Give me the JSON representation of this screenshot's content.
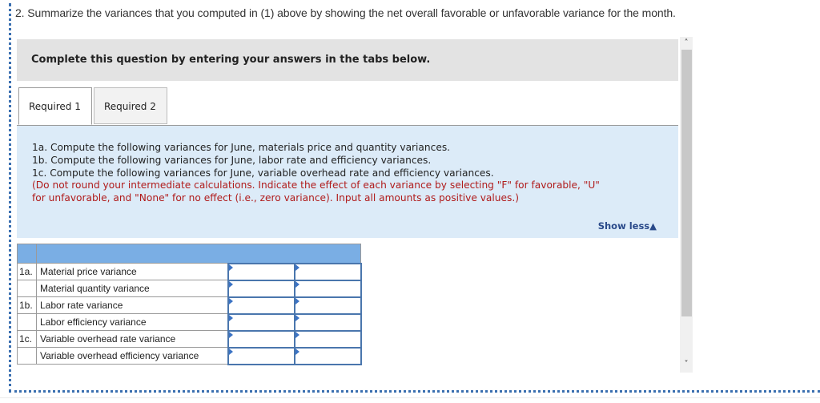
{
  "question": {
    "text": "2. Summarize the variances that you computed in (1) above by showing the net overall favorable or unfavorable variance for the month."
  },
  "instruction_bar": {
    "text": "Complete this question by entering your answers in the tabs below."
  },
  "tabs": [
    {
      "label": "Required 1",
      "active": true
    },
    {
      "label": "Required 2",
      "active": false
    }
  ],
  "info_panel": {
    "lines": [
      "1a. Compute the following variances for June, materials price and quantity variances.",
      "1b. Compute the following variances for June, labor rate and efficiency variances.",
      "1c. Compute the following variances for June, variable overhead rate and efficiency variances."
    ],
    "note_lines": [
      "(Do not round your intermediate calculations. Indicate the effect of each variance by selecting \"F\" for favorable, \"U\"",
      "for unfavorable, and \"None\" for no effect (i.e., zero variance). Input all amounts as positive values.)"
    ],
    "show_less_label": "Show less",
    "show_less_icon": "▲"
  },
  "table": {
    "rows": [
      {
        "prefix": "1a.",
        "label": "Material price variance",
        "amount": "",
        "effect": ""
      },
      {
        "prefix": "",
        "label": "Material quantity variance",
        "amount": "",
        "effect": ""
      },
      {
        "prefix": "1b.",
        "label": "Labor rate variance",
        "amount": "",
        "effect": ""
      },
      {
        "prefix": "",
        "label": "Labor efficiency variance",
        "amount": "",
        "effect": ""
      },
      {
        "prefix": "1c.",
        "label": "Variable overhead rate variance",
        "amount": "",
        "effect": ""
      },
      {
        "prefix": "",
        "label": "Variable overhead efficiency variance",
        "amount": "",
        "effect": ""
      }
    ]
  },
  "scrollbar": {
    "up_icon": "˄",
    "down_icon": "˅"
  },
  "colors": {
    "header_blue": "#7aaee4",
    "panel_blue": "#dcebf8",
    "note_red": "#b01b1b",
    "link_blue": "#2a4a8a"
  }
}
